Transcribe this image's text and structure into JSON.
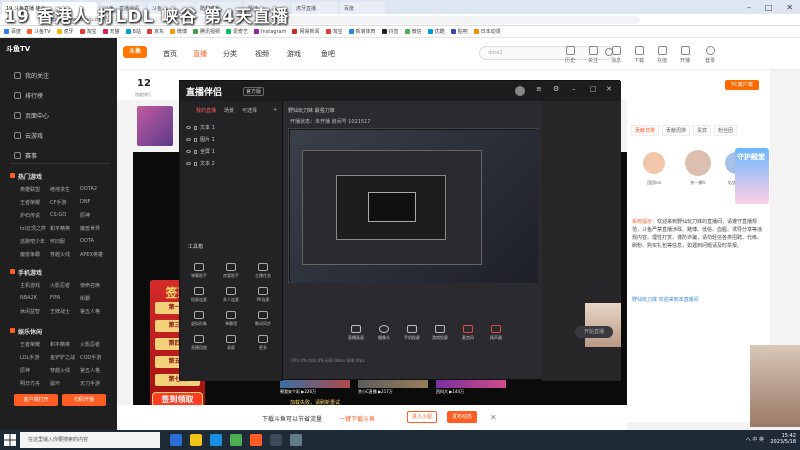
{
  "browser": {
    "tabs": [
      {
        "label": "19 斗鱼直播 峡谷",
        "active": true
      },
      {
        "label": "斗鱼 - 直播伴侣"
      },
      {
        "label": "斗鱼"
      },
      {
        "label": "酷我音乐"
      },
      {
        "label": "猜谜"
      },
      {
        "label": "虎牙直播"
      },
      {
        "label": "百度"
      }
    ],
    "address": "https://www.douyu.com/",
    "bookmarks": [
      "百度",
      "斗鱼TV",
      "虎牙",
      "淘宝",
      "天猫",
      "B站",
      "京东",
      "微博",
      "腾讯视频",
      "爱奇艺",
      "Instagram",
      "网易新闻",
      "淘宝",
      "新浪体育",
      "抖音",
      "微信",
      "优酷",
      "贴吧",
      "日本动漫"
    ]
  },
  "stream_title_overlay": "19  香港人 打LDL 峡谷 第4天直播",
  "sidebar": {
    "logo": "斗鱼TV",
    "items": [
      "我的关注",
      "排行榜",
      "页面中心",
      "云游戏",
      "赛事"
    ],
    "section_hot": "热门游戏",
    "hot_games": [
      "英雄联盟",
      "绝地求生",
      "DOTA2",
      "王者荣耀",
      "CF手游",
      "DNF",
      "炉石传说",
      "CS:GO",
      "原神",
      "lol云顶之弈",
      "和平精英",
      "魔兽世界",
      "逃跑吧少年",
      "怀旧服",
      "DOTA",
      "魔兽争霸",
      "穿越火线",
      "APEX英雄"
    ],
    "section_mobile": "手机游戏",
    "mobile_games": [
      "主机游戏",
      "火影忍者",
      "使命召唤",
      "NBA2K",
      "FIFA",
      "街霸",
      "休闲益智",
      "王牌战士",
      "第五人格"
    ],
    "section_board": "娱乐休闲",
    "board_games": [
      "王者荣耀",
      "和平精英",
      "火影忍者",
      "LOL手游",
      "金铲铲之战",
      "COD手游",
      "原神",
      "穿越火线",
      "第五人格",
      "明日方舟",
      "崩坏",
      "天刀手游"
    ],
    "btn_client": "客户端打开",
    "btn_open": "扫码开播"
  },
  "site_header": {
    "logo": "斗鱼",
    "nav": [
      "首页",
      "直播",
      "分类",
      "视频",
      "游戏",
      "鱼吧"
    ],
    "search_placeholder": "dota2",
    "icons": [
      "历史",
      "关注",
      "消息",
      "下载",
      "充值",
      "开播",
      "登录"
    ]
  },
  "room": {
    "rank_number": "12",
    "rank_sub": "热度排行"
  },
  "streamer_app": {
    "title": "直播伴侣",
    "badge": "官方版",
    "scene_tabs": [
      "我的直播",
      "场景",
      "可选择",
      "+"
    ],
    "scenes": [
      "文本 1",
      "图片 1",
      "全屏 1",
      "文本 2"
    ],
    "tools_title": "工具箱",
    "tools": [
      "弹幕助手",
      "房管助手",
      "主播任务",
      "投屏连麦",
      "多人连麦",
      "PK连麦",
      "虚拟形象",
      "弹幕墙",
      "歌词同步",
      "直播回放",
      "录屏",
      "更多"
    ],
    "room_label": "野仙玩刀妹  最强刀妹",
    "room_status": "开播状态：未开播  房间号 1021517",
    "controls": [
      "直播画面",
      "摄像头",
      "手机投屏",
      "游戏投屏",
      "麦克风",
      "扬声器"
    ],
    "start_label": "开始直播",
    "status_line": "CPU:0%  内存:0%  码率:0kb/s  帧率:0fps"
  },
  "sign": {
    "title": "签到",
    "days": [
      "第一天",
      "第三天",
      "第四天",
      "第五天",
      "第七天"
    ],
    "button": "签到领取"
  },
  "right_panel": {
    "pc_button": "PC客户端",
    "tabs": [
      "贡献日排",
      "贡献周排",
      "贵宾",
      "粉丝团"
    ],
    "top3": [
      "团团lok",
      "侠一棵lk",
      "龙战士·凯"
    ],
    "guard_title": "守护殿堂",
    "chat_system": "系统提示：",
    "chat_text": "欢迎来到野仙玩刀妹的直播间，请遵守直播规范，斗鱼严禁直播涉政、赌博、低俗、血腥、诱导分享等违规内容。理性打赏，谨防诈骗，请勿轻信各类招聘、代练、刷粉、购买礼包等信息，如遇到问题请及时举报。",
    "chat_line2": "野仙玩刀妹  欢迎来到本直播间"
  },
  "strip": {
    "items": [
      {
        "name": "朝我安个彩",
        "stat": "226万"
      },
      {
        "name": "余小C直播",
        "stat": "217万"
      },
      {
        "name": "西科大",
        "stat": "144万"
      }
    ],
    "notice": "加载失败，请刷新重试"
  },
  "download_bar": {
    "text": "下载斗鱼可以节省流量",
    "link": "一键下载斗鱼",
    "enter": "进入小屋",
    "publish": "发布动态"
  },
  "taskbar": {
    "search": "在这里输入你要搜索的内容",
    "tray": "へ 中 英",
    "time": "15:42",
    "date": "2023/5/18"
  }
}
